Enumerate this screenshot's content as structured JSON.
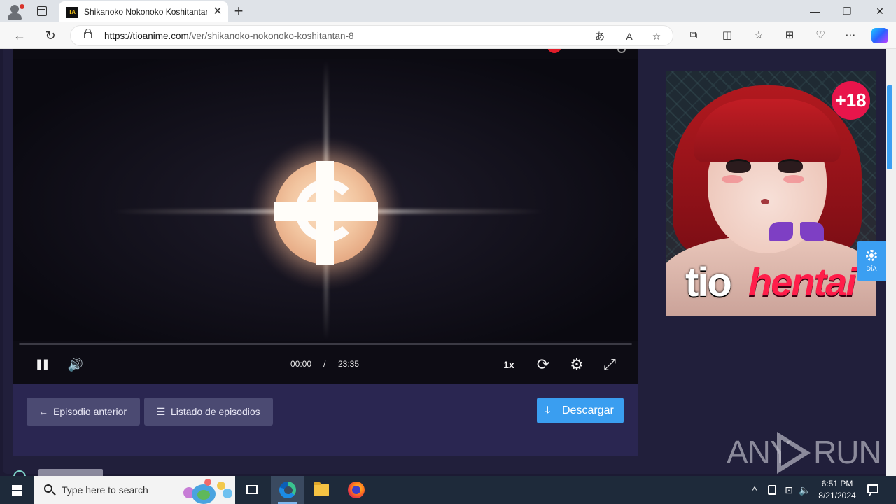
{
  "browser": {
    "tab_title": "Shikanoko Nokonoko Koshitantan",
    "favicon_text": "TA",
    "url_domain": "https://tioanime.com",
    "url_path": "/ver/shikanoko-nokonoko-koshitantan-8",
    "tab_close": "✕",
    "new_tab": "+",
    "window_controls": {
      "minimize": "—",
      "restore": "❐",
      "close": "✕"
    },
    "nav": {
      "back": "←",
      "refresh": "↻"
    },
    "omnibox_icons": {
      "translate": "あ",
      "read_aloud": "A",
      "favorite": "☆"
    },
    "toolbar": {
      "extensions": "⧉",
      "split": "◫",
      "favorites": "☆",
      "collections": "⊞",
      "performance": "♡",
      "more": "⋯"
    }
  },
  "player": {
    "current_time": "00:00",
    "separator": "/",
    "duration": "23:35",
    "progress": 0.0,
    "speed": "1x",
    "icons": {
      "pause": "❚❚",
      "volume": "🔊",
      "loop": "⟳",
      "settings": "⚙",
      "fullscreen": "⤢"
    }
  },
  "episode_nav": {
    "prev_label": "Episodio anterior",
    "prev_icon": "←",
    "list_label": "Listado de episodios",
    "list_icon": "☰",
    "download_label": "Descargar",
    "download_icon": "⤓"
  },
  "ad": {
    "badge": "+18",
    "logo_part1": "tio",
    "logo_part2": "hentai"
  },
  "theme_toggle": {
    "label": "DÍA"
  },
  "watermark": {
    "left": "ANY",
    "right": "RUN"
  },
  "taskbar": {
    "search_placeholder": "Type here to search",
    "time": "6:51 PM",
    "date": "8/21/2024",
    "tray_icons": {
      "chevron": "^",
      "network": "⊡",
      "volume": "🔈"
    }
  },
  "colors": {
    "page_bg": "#1c1a33",
    "panel_bg": "#2a2651",
    "button_bg": "#4b4a72",
    "accent_blue": "#3a9ef0",
    "ad_logo_red": "#ff1e4a"
  }
}
